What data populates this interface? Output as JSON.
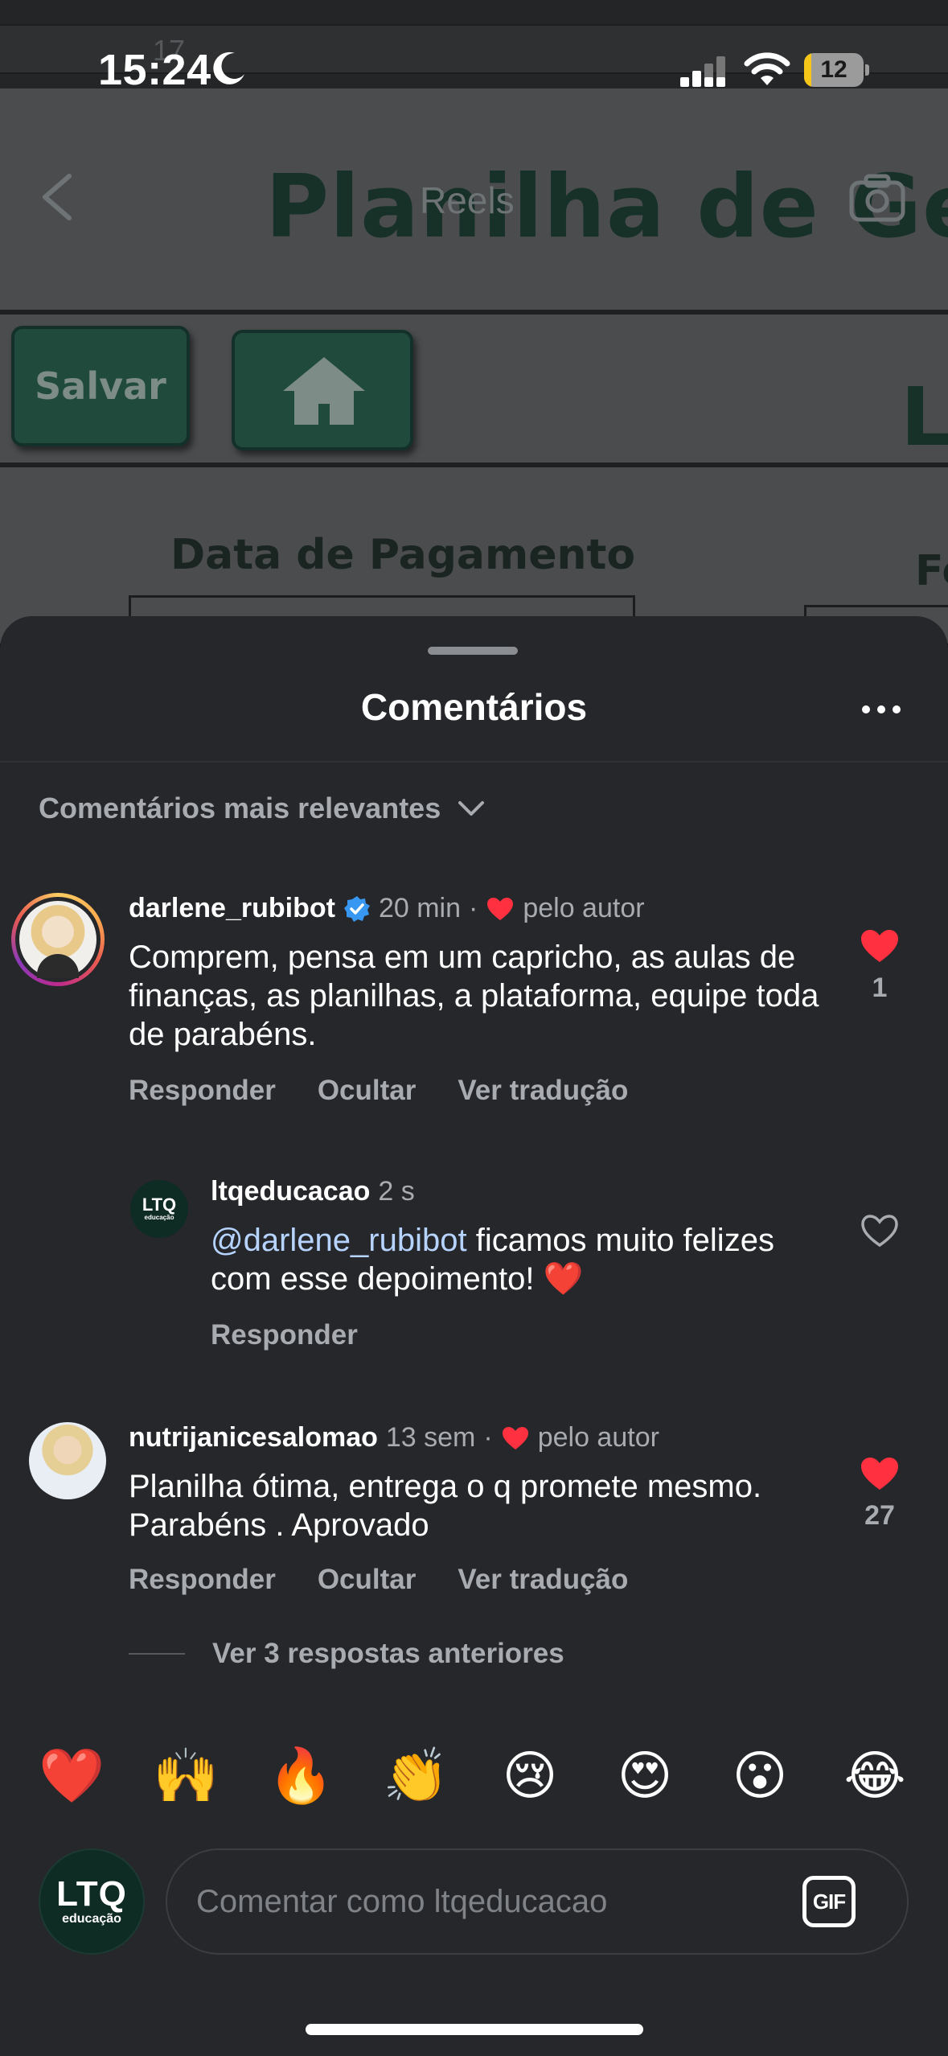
{
  "status_bar": {
    "time": "15:24",
    "battery_level": "12",
    "battery_fraction": 0.12
  },
  "background": {
    "header_label": "Reels",
    "sheet_title": "Planilha de Gestã",
    "save_button": "Salvar",
    "field_label": "Data de Pagamento",
    "field_label_2": "Fo",
    "partial_letter": "L",
    "formula_value": "17"
  },
  "sheet": {
    "title": "Comentários",
    "sort_label": "Comentários mais relevantes"
  },
  "comments": [
    {
      "username": "darlene_rubibot",
      "verified": true,
      "time": "20 min",
      "liked_by_author": "pelo autor",
      "text": "Comprem, pensa em um capricho, as aulas de finanças, as planilhas, a plataforma, equipe toda de parabéns.",
      "likes": "1",
      "liked": true,
      "actions": [
        "Responder",
        "Ocultar",
        "Ver tradução"
      ]
    },
    {
      "username": "ltqeducacao",
      "avatar_text": "LTQ",
      "avatar_subtext": "educação",
      "time": "2 s",
      "mention": "@darlene_rubibot",
      "text": " ficamos muito felizes com esse depoimento! ❤️",
      "liked": false,
      "actions": [
        "Responder"
      ]
    },
    {
      "username": "nutrijanicesalomao",
      "time": "13 sem",
      "liked_by_author": "pelo autor",
      "text": "Planilha ótima, entrega o q promete mesmo. Parabéns . Aprovado",
      "likes": "27",
      "liked": true,
      "actions": [
        "Responder",
        "Ocultar",
        "Ver tradução"
      ]
    }
  ],
  "view_replies": "Ver 3 respostas anteriores",
  "emojis": [
    "❤️",
    "🙌",
    "🔥",
    "👏",
    "😢",
    "😍",
    "😮",
    "😂"
  ],
  "composer": {
    "avatar_text": "LTQ",
    "avatar_subtext": "educação",
    "placeholder": "Comentar como ltqeducacao",
    "gif_label": "GIF"
  },
  "colors": {
    "sheet_bg": "#25272b",
    "like_red": "#ff3040",
    "mention_blue": "#b6d4ff",
    "secondary_text": "#a8abb0"
  }
}
